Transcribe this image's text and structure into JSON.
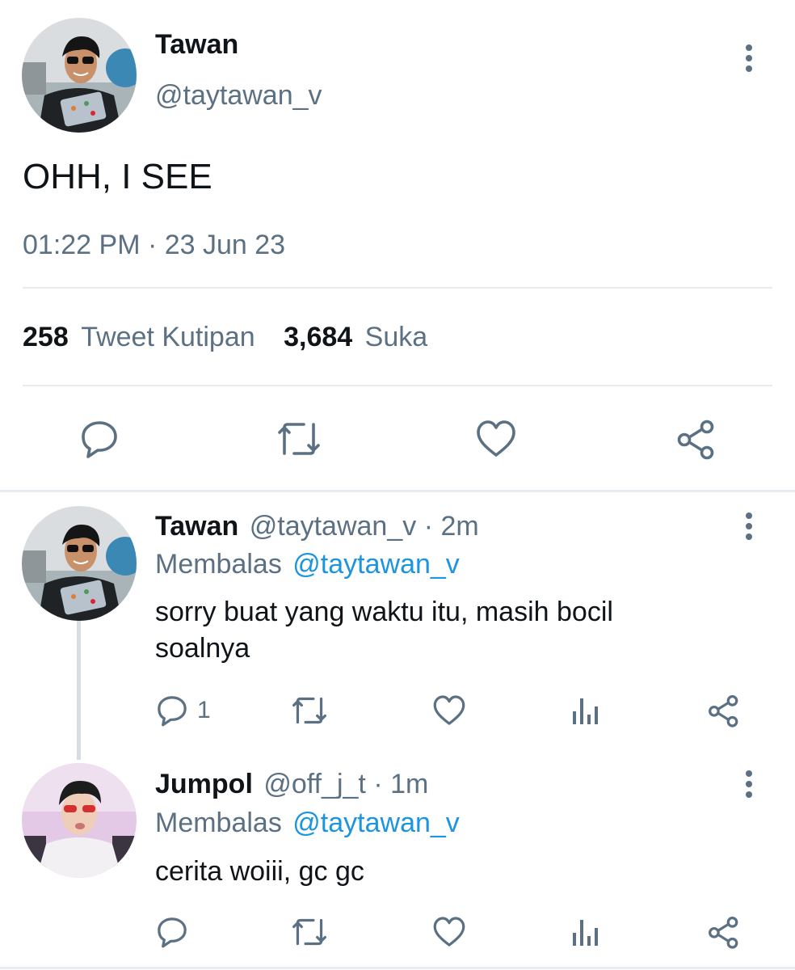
{
  "main_tweet": {
    "author_name": "Tawan",
    "handle": "@taytawan_v",
    "text": "OHH, I SEE",
    "timestamp": "01:22 PM · 23 Jun 23",
    "quote_count": "258",
    "quote_label": "Tweet Kutipan",
    "like_count": "3,684",
    "like_label": "Suka"
  },
  "replies": [
    {
      "author_name": "Tawan",
      "handle_time": "@taytawan_v · 2m",
      "replying_prefix": "Membalas",
      "replying_to": "@taytawan_v",
      "text_line1": "sorry buat yang waktu itu, masih bocil",
      "text_line2": "soalnya",
      "reply_count": "1"
    },
    {
      "author_name": "Jumpol",
      "handle_time": "@off_j_t · 1m",
      "replying_prefix": "Membalas",
      "replying_to": "@taytawan_v",
      "text_line1": "cerita woiii, gc gc",
      "reply_count": ""
    }
  ],
  "icons": {
    "reply": "speech-bubble-icon",
    "retweet": "retweet-arrows-icon",
    "like": "heart-outline-icon",
    "share": "share-nodes-icon",
    "analytics": "bar-chart-icon",
    "more": "vertical-ellipsis-icon"
  },
  "colors": {
    "text": "#0f1419",
    "secondary": "#5b7083",
    "link": "#1b95e0",
    "divider": "#e6ecf0"
  }
}
